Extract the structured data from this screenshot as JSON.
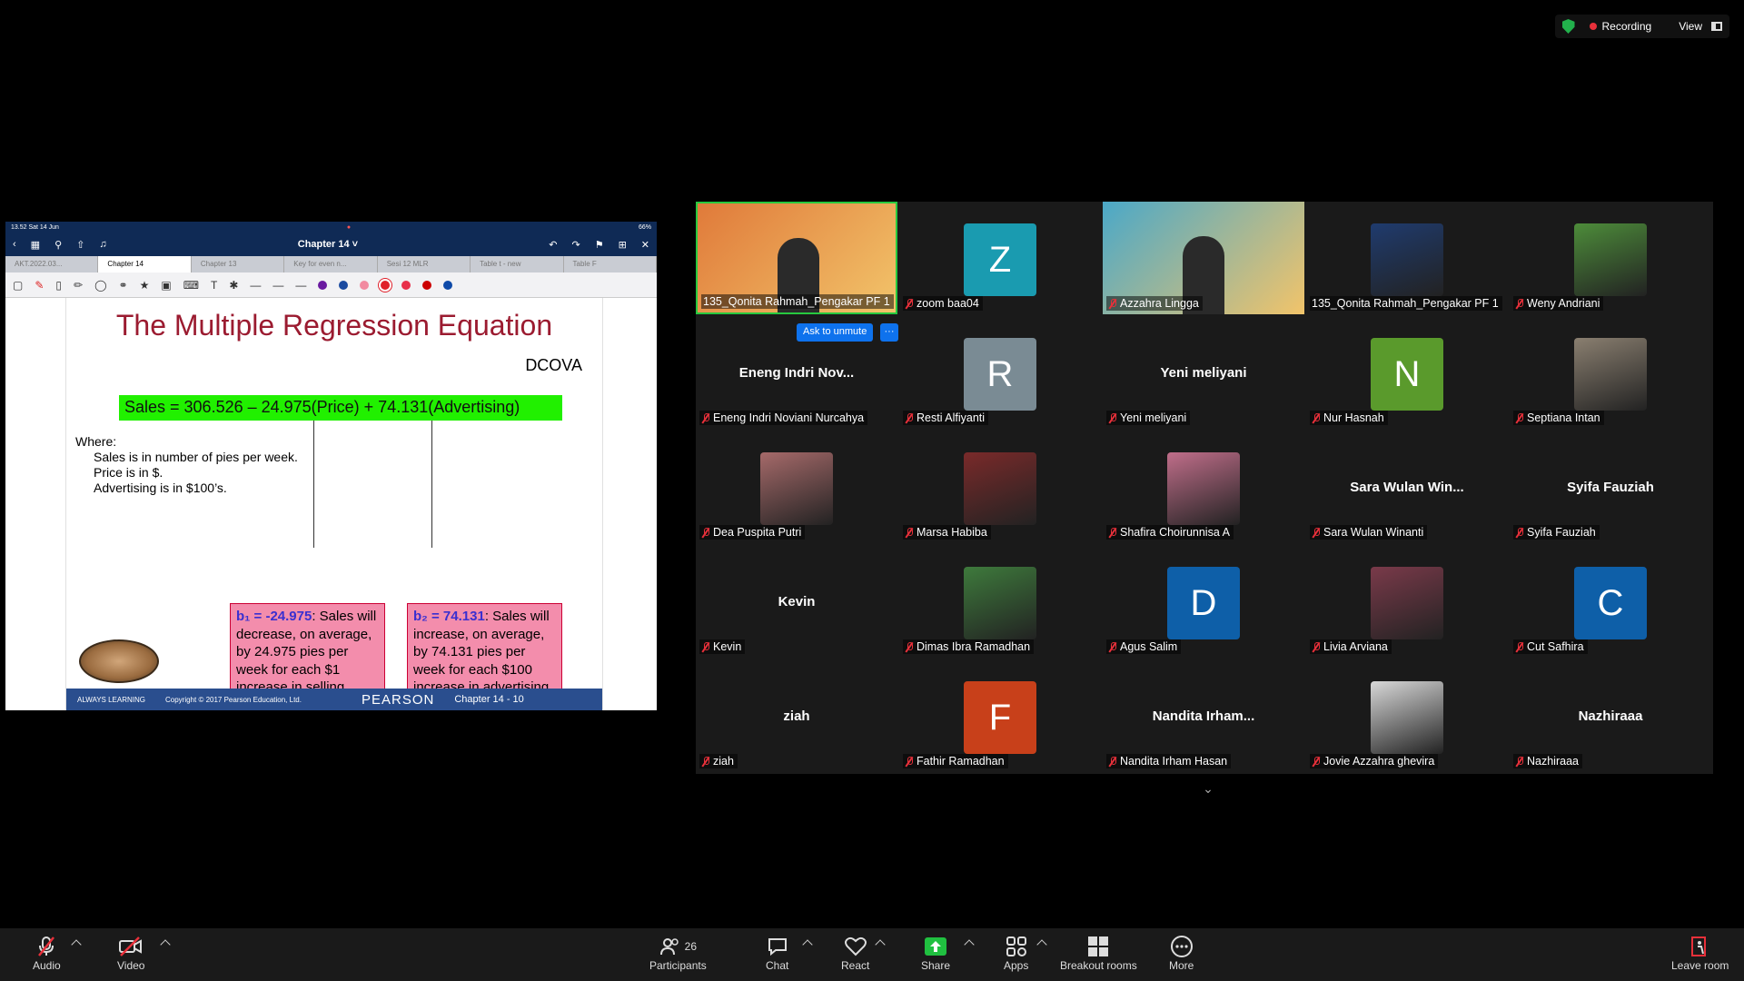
{
  "top_status": {
    "recording": "Recording",
    "view": "View"
  },
  "ipad": {
    "status_left": "13.52  Sat 14 Jun",
    "status_right": "66%",
    "nav_title": "Chapter 14 ˅",
    "tabs": [
      "AKT.2022.03...",
      "Chapter 14",
      "Chapter 13",
      "Key for even n...",
      "Sesi 12 MLR",
      "Table t - new",
      "Table F"
    ]
  },
  "slide": {
    "title": "The Multiple Regression Equation",
    "dcova": "DCOVA",
    "equation": "Sales = 306.526 – 24.975(Price) + 74.131(Advertising)",
    "where_label": "Where:",
    "where_lines": [
      "Sales is in number of pies per week.",
      "Price is in $.",
      "Advertising is in $100’s."
    ],
    "box1_coef": "b₁ = -24.975",
    "box1_text": ": Sales will decrease, on average, by 24.975 pies per week for each $1 increase in selling price, net of the effects of changes due to advertising",
    "box2_coef": "b₂ = 74.131",
    "box2_text": ": Sales will increase, on average, by 74.131 pies per week for each $100 increase in advertising, net of the effects of changes due to price",
    "footer_left": "ALWAYS LEARNING",
    "footer_copy": "Copyright © 2017 Pearson Education, Ltd.",
    "footer_brand": "PEARSON",
    "footer_chapter": "Chapter 14 - 10"
  },
  "gallery": {
    "unmute_label": "Ask to unmute",
    "unmute_more": "···",
    "tiles": [
      {
        "name": "135_Qonita Rahmah_Pengakar PF 1",
        "kind": "video",
        "color": "#e07a3a"
      },
      {
        "name": "zoom baa04",
        "kind": "letter",
        "letter": "Z",
        "color": "#1a9bb0"
      },
      {
        "name": "Azzahra Lingga",
        "kind": "video",
        "color": "#4aa8c8"
      },
      {
        "name": "135_Qonita Rahmah_Pengakar PF 1",
        "kind": "photo",
        "color": "#1f3b6e"
      },
      {
        "name": "Weny Andriani",
        "kind": "photo",
        "color": "#4d8c3a"
      },
      {
        "name": "Eneng Indri Noviani Nurcahya",
        "kind": "text",
        "big": "Eneng  Indri  Nov..."
      },
      {
        "name": "Resti Alfiyanti",
        "kind": "letter",
        "letter": "R",
        "color": "#7a8b94"
      },
      {
        "name": "Yeni meliyani",
        "kind": "text",
        "big": "Yeni meliyani"
      },
      {
        "name": "Nur Hasnah",
        "kind": "letter",
        "letter": "N",
        "color": "#5a9a2c"
      },
      {
        "name": "Septiana Intan",
        "kind": "photo",
        "color": "#8a7f70"
      },
      {
        "name": "Dea Puspita Putri",
        "kind": "photo",
        "color": "#a66a6a"
      },
      {
        "name": "Marsa Habiba",
        "kind": "photo",
        "color": "#7a2a2a"
      },
      {
        "name": "Shafira Choirunnisa A",
        "kind": "photo",
        "color": "#c06e8a"
      },
      {
        "name": "Sara Wulan Winanti",
        "kind": "text",
        "big": "Sara  Wulan  Win..."
      },
      {
        "name": "Syifa Fauziah",
        "kind": "text",
        "big": "Syifa Fauziah"
      },
      {
        "name": "Kevin",
        "kind": "text",
        "big": "Kevin"
      },
      {
        "name": "Dimas Ibra Ramadhan",
        "kind": "photo",
        "color": "#3e7a3c"
      },
      {
        "name": "Agus Salim",
        "kind": "letter",
        "letter": "D",
        "color": "#0e5fa8"
      },
      {
        "name": "Livia Arviana",
        "kind": "photo",
        "color": "#7a3a4a"
      },
      {
        "name": "Cut Safhira",
        "kind": "letter",
        "letter": "C",
        "color": "#0e5fa8"
      },
      {
        "name": "ziah",
        "kind": "text",
        "big": "ziah"
      },
      {
        "name": "Fathir Ramadhan",
        "kind": "letter",
        "letter": "F",
        "color": "#c8401a"
      },
      {
        "name": "Nandita Irham Hasan",
        "kind": "text",
        "big": "Nandita  Irham..."
      },
      {
        "name": "Jovie Azzahra ghevira",
        "kind": "photo",
        "color": "#d8d8d8"
      },
      {
        "name": "Nazhiraaa",
        "kind": "text",
        "big": "Nazhiraaa"
      }
    ]
  },
  "toolbar": {
    "audio": "Audio",
    "video": "Video",
    "participants": "Participants",
    "participants_count": "26",
    "chat": "Chat",
    "react": "React",
    "share": "Share",
    "apps": "Apps",
    "breakout": "Breakout rooms",
    "more": "More",
    "leave": "Leave room"
  }
}
